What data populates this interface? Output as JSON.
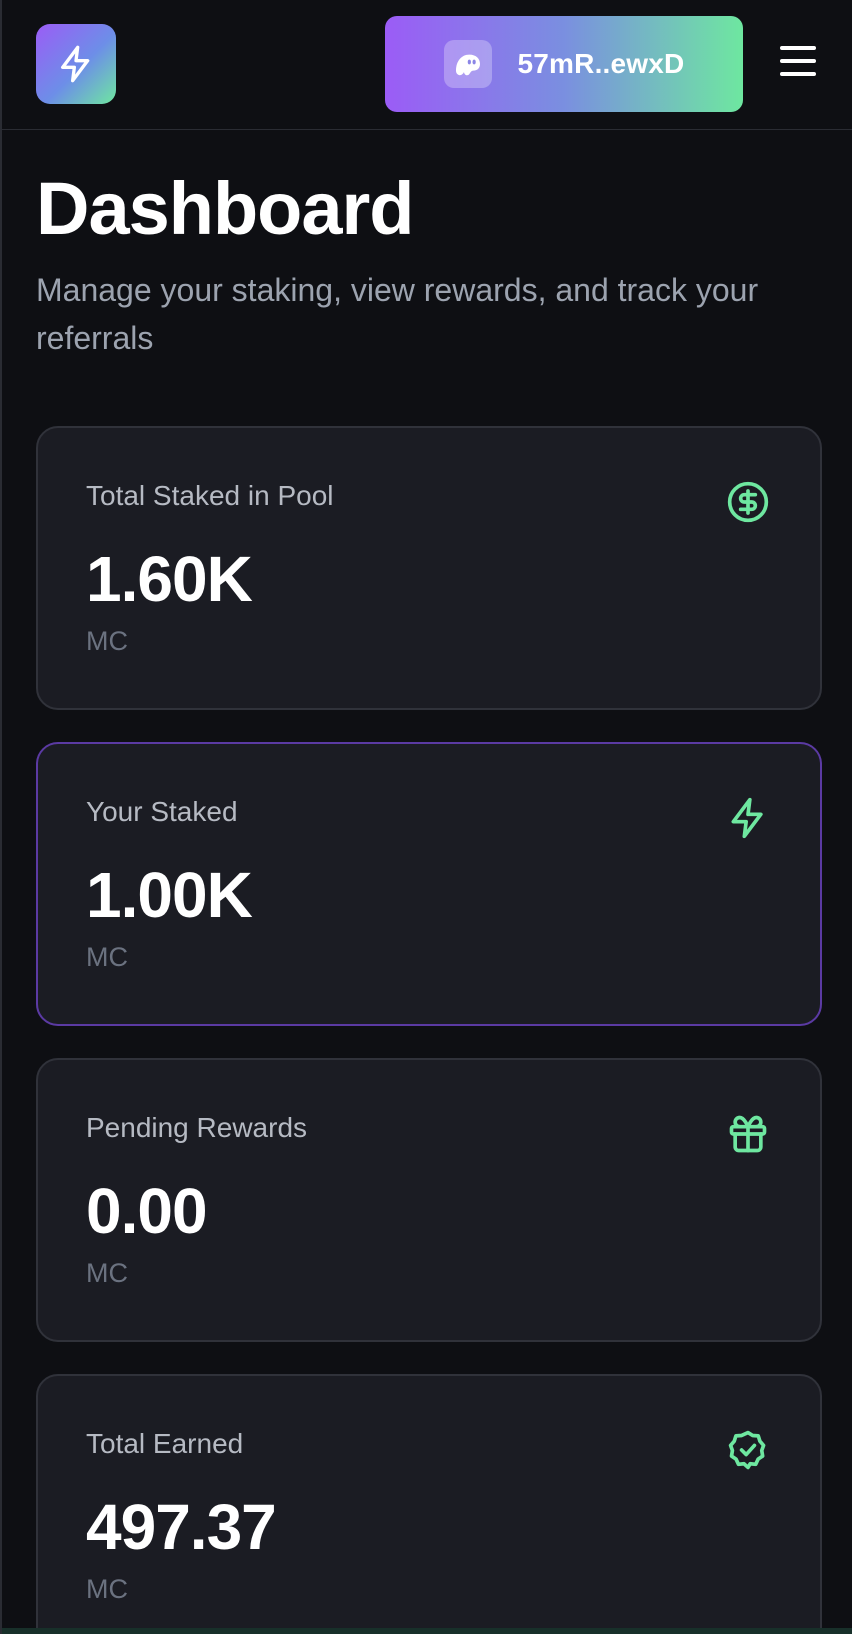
{
  "header": {
    "logo_icon": "lightning-bolt-icon",
    "wallet": {
      "avatar_icon": "phantom-ghost-icon",
      "address": "57mR..ewxD"
    },
    "menu_icon": "hamburger-menu-icon"
  },
  "page": {
    "title": "Dashboard",
    "subtitle": "Manage your staking, view rewards, and track your referrals"
  },
  "cards": [
    {
      "label": "Total Staked in Pool",
      "value": "1.60K",
      "unit": "MC",
      "icon": "dollar-circle-icon",
      "highlighted": false
    },
    {
      "label": "Your Staked",
      "value": "1.00K",
      "unit": "MC",
      "icon": "lightning-bolt-icon",
      "highlighted": true
    },
    {
      "label": "Pending Rewards",
      "value": "0.00",
      "unit": "MC",
      "icon": "gift-icon",
      "highlighted": false
    },
    {
      "label": "Total Earned",
      "value": "497.37",
      "unit": "MC",
      "icon": "verified-badge-icon",
      "highlighted": false
    }
  ],
  "colors": {
    "background": "#0e0f13",
    "card_background": "#1b1c23",
    "accent_green": "#6ee7a0",
    "accent_purple": "#9b5cf6",
    "highlight_border": "#5b3aa3"
  }
}
